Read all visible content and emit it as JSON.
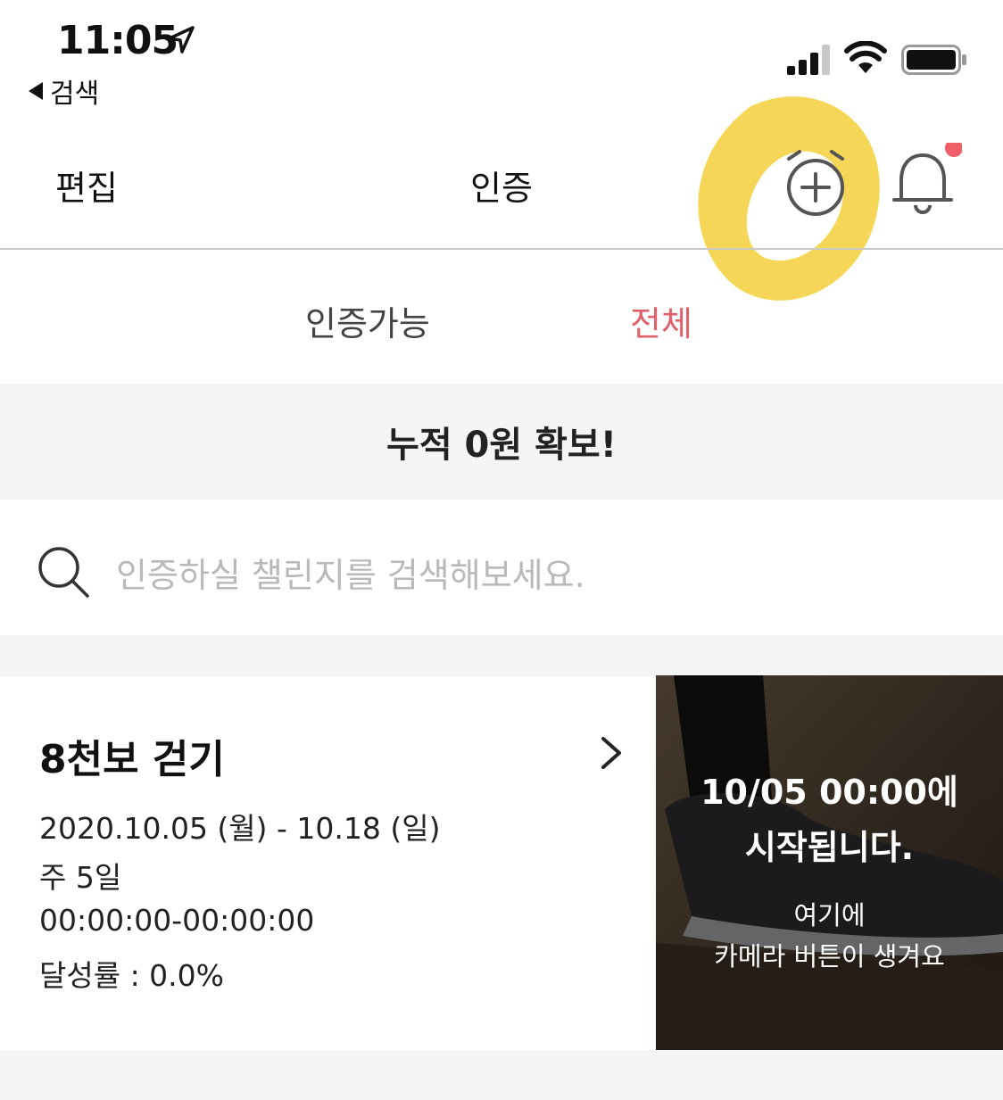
{
  "status_bar": {
    "time": "11:05",
    "back_label": "검색",
    "icons": [
      "location-arrow-icon",
      "signal-icon",
      "wifi-icon",
      "battery-icon"
    ]
  },
  "nav": {
    "edit_label": "편집",
    "title": "인증",
    "alarm_icon": "alarm-plus-icon",
    "bell_icon": "bell-icon",
    "bell_badge_color": "#ef5f67",
    "highlight_color": "#f7d23e"
  },
  "tabs": {
    "available_label": "인증가능",
    "all_label": "전체",
    "active": "전체",
    "active_color": "#e0616a"
  },
  "banner": {
    "text": "누적 0원 확보!"
  },
  "search": {
    "placeholder": "인증하실 챌린지를 검색해보세요."
  },
  "challenge": {
    "title": "8천보 걷기",
    "period": "2020.10.05 (월) - 10.18 (일)",
    "frequency": "주 5일",
    "time_range": "00:00:00-00:00:00",
    "achievement": "달성률 : 0.0%",
    "thumbnail": {
      "start_line1": "10/05 00:00에",
      "start_line2": "시작됩니다.",
      "hint_line1": "여기에",
      "hint_line2": "카메라 버튼이 생겨요"
    }
  }
}
